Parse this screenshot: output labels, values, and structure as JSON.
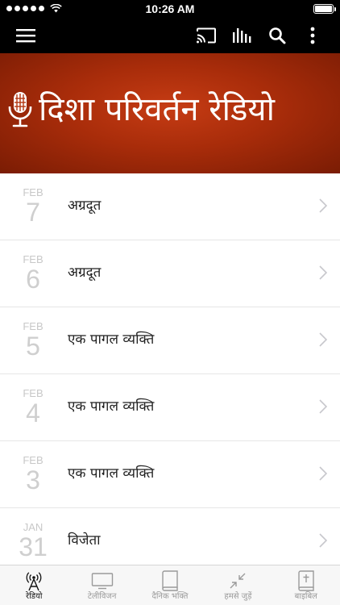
{
  "status_bar": {
    "time": "10:26 AM"
  },
  "banner": {
    "title": "दिशा  परिवर्तन रेडियो"
  },
  "episodes": [
    {
      "month": "FEB",
      "day": "7",
      "title": "अग्रदूत"
    },
    {
      "month": "FEB",
      "day": "6",
      "title": "अग्रदूत"
    },
    {
      "month": "FEB",
      "day": "5",
      "title": "एक पागल व्यक्ति"
    },
    {
      "month": "FEB",
      "day": "4",
      "title": "एक पागल व्यक्ति"
    },
    {
      "month": "FEB",
      "day": "3",
      "title": "एक पागल व्यक्ति"
    },
    {
      "month": "JAN",
      "day": "31",
      "title": "विजेता"
    }
  ],
  "tabs": [
    {
      "label": "रेडियो",
      "icon": "radio-tower-icon",
      "active": true
    },
    {
      "label": "टेलीविजन",
      "icon": "tv-icon",
      "active": false
    },
    {
      "label": "दैनिक भक्ति",
      "icon": "book-icon",
      "active": false
    },
    {
      "label": "हमसे जुड़ें",
      "icon": "connect-arrows-icon",
      "active": false
    },
    {
      "label": "बाइबिल",
      "icon": "bible-icon",
      "active": false
    }
  ],
  "colors": {
    "banner": "#a82c0a",
    "topbar": "#000000",
    "tab_active": "#111111",
    "tab_inactive": "#9a9a9a"
  }
}
